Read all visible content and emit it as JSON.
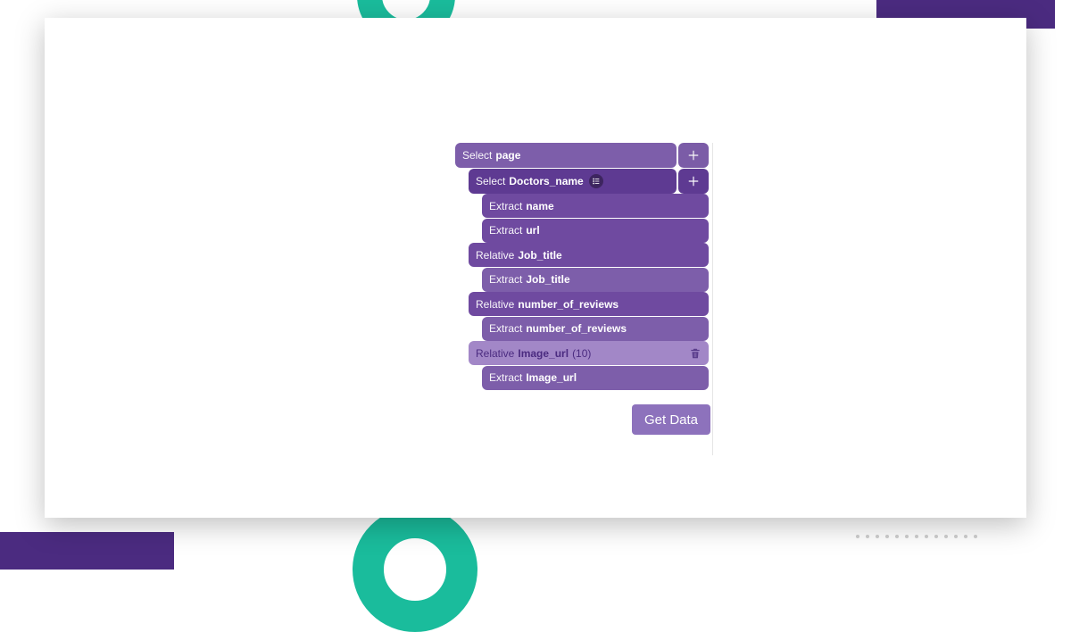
{
  "selectors": {
    "root": {
      "action": "Select",
      "name": "page"
    },
    "doctors": {
      "action": "Select",
      "name": "Doctors_name"
    },
    "extract_name": {
      "action": "Extract",
      "name": "name"
    },
    "extract_url": {
      "action": "Extract",
      "name": "url"
    },
    "rel_job": {
      "action": "Relative",
      "name": "Job_title"
    },
    "extract_job": {
      "action": "Extract",
      "name": "Job_title"
    },
    "rel_reviews": {
      "action": "Relative",
      "name": "number_of_reviews"
    },
    "extract_reviews": {
      "action": "Extract",
      "name": "number_of_reviews"
    },
    "rel_image": {
      "action": "Relative",
      "name": "Image_url",
      "count": "(10)"
    },
    "extract_image": {
      "action": "Extract",
      "name": "Image_url"
    }
  },
  "buttons": {
    "get_data": "Get Data"
  }
}
